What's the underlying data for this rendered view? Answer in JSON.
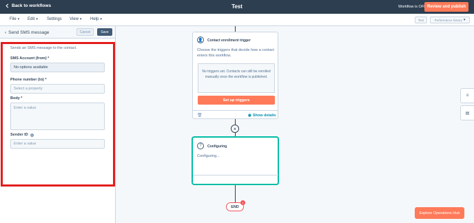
{
  "topbar": {
    "back_label": "Back to workflows",
    "title": "Test",
    "status": "Workflow is OFF",
    "publish_label": "Review and publish"
  },
  "menubar": {
    "menus": [
      "File",
      "Edit",
      "Settings",
      "View",
      "Help"
    ],
    "test_label": "Test",
    "perf_label": "Performance history"
  },
  "panel": {
    "title": "Send SMS message",
    "cancel_label": "Cancel",
    "save_label": "Save",
    "description": "Sends an SMS message to the contact.",
    "fields": {
      "sms_account_label": "SMS Account (from) *",
      "sms_account_value": "No options available",
      "phone_label": "Phone number (to) *",
      "phone_placeholder": "Select a property",
      "body_label": "Body *",
      "body_placeholder": "Enter a value",
      "sender_label": "Sender ID",
      "sender_placeholder": "Enter a value"
    }
  },
  "canvas": {
    "trigger_card": {
      "title": "Contact enrollment trigger",
      "desc": "Choose the triggers that decide how a contact enters this workflow.",
      "empty_text": "No triggers set. Contacts can still be enrolled manually once the workflow is published.",
      "setup_label": "Set up triggers",
      "show_details": "Show details"
    },
    "config_card": {
      "title": "Configuring",
      "body": "Configuring..."
    },
    "end_label": "END",
    "end_badge": "1"
  },
  "explore_label": "Explore Operations Hub"
}
